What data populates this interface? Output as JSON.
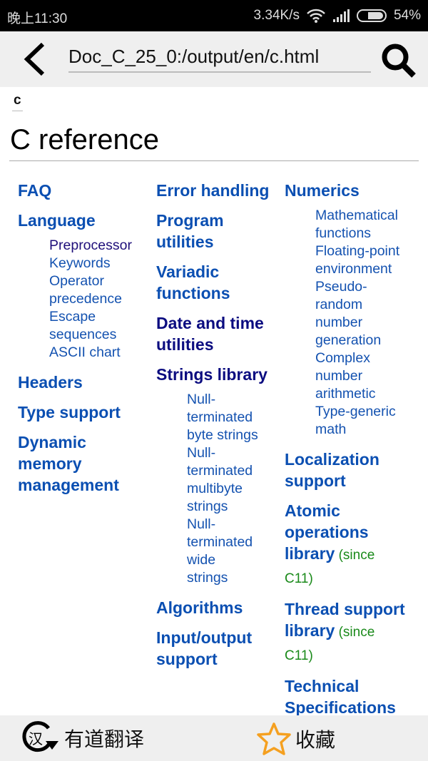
{
  "status": {
    "time": "晚上11:30",
    "speed": "3.34K/s",
    "battery": "54%",
    "battery_level": 0.54
  },
  "toolbar": {
    "url": "Doc_C_25_0:/output/en/c.html"
  },
  "breadcrumb": "c",
  "title": "C reference",
  "columns": [
    {
      "items": [
        {
          "label": "FAQ"
        },
        {
          "label": "Language",
          "subs": [
            "Preprocessor",
            "Keywords",
            "Operator\nprecedence",
            "Escape\nsequences",
            "ASCII chart"
          ]
        },
        {
          "label": "Headers"
        },
        {
          "label": "Type support"
        },
        {
          "label": "Dynamic\nmemory\nmanagement"
        }
      ]
    },
    {
      "items": [
        {
          "label": "Error handling"
        },
        {
          "label": "Program\nutilities"
        },
        {
          "label": "Variadic\nfunctions"
        },
        {
          "label": "Date and time\nutilities"
        },
        {
          "label": "Strings library",
          "subs": [
            "Null-\nterminated\nbyte strings",
            "Null-\nterminated\nmultibyte\nstrings",
            "Null-\nterminated\nwide\nstrings"
          ]
        },
        {
          "label": "Algorithms"
        },
        {
          "label": "Input/output\nsupport"
        }
      ]
    },
    {
      "items": [
        {
          "label": "Numerics",
          "subs": [
            "Mathematical\nfunctions",
            "Floating-point\nenvironment",
            "Pseudo-\nrandom\nnumber\ngeneration",
            "Complex\nnumber\narithmetic",
            "Type-generic\nmath"
          ]
        },
        {
          "label": "Localization\nsupport"
        },
        {
          "label": "Atomic\noperations\nlibrary",
          "since": " (since\nC11)"
        },
        {
          "label": "Thread support\nlibrary",
          "since": " (since\nC11)"
        },
        {
          "label": "Technical\nSpecifications"
        }
      ]
    }
  ],
  "bottom": {
    "translate": "有道翻译",
    "favorite": "收藏"
  },
  "colors": {
    "link": "#0b4fb2",
    "visited": "#0b0c80",
    "since": "#1a8a1a",
    "star": "#f5a020"
  }
}
